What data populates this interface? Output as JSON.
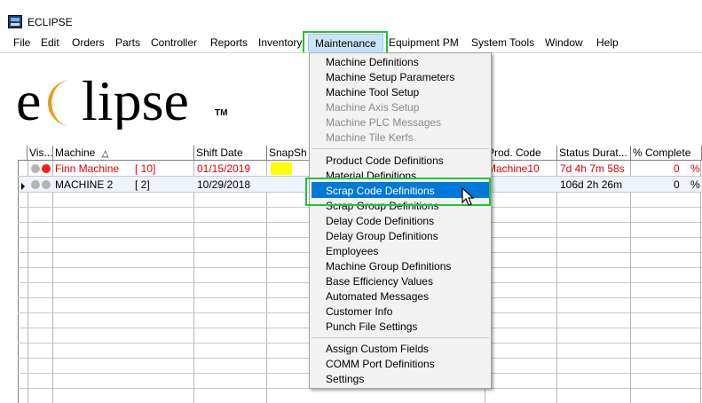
{
  "window": {
    "title": "ECLIPSE"
  },
  "menubar": {
    "items": [
      "File",
      "Edit",
      "Orders",
      "Parts",
      "Controller",
      "Reports",
      "Inventory",
      "Maintenance",
      "Equipment PM",
      "System Tools",
      "Window",
      "Help"
    ],
    "active": "Maintenance"
  },
  "logo": {
    "text": "eclipse",
    "trademark": "TM"
  },
  "grid": {
    "columns": [
      "Vis...",
      "Machine",
      "Shift Date",
      "SnapSh",
      "Prod. Code",
      "Status Durat...",
      "% Complete"
    ],
    "rows": [
      {
        "machine": "Finn Machine",
        "machine_id": "[ 10]",
        "shift_date": "01/15/2019",
        "prod_code": "Machine10",
        "status_duration": "7d 4h 7m 58s",
        "complete": "0",
        "pct": "%",
        "color": "#e00000"
      },
      {
        "machine": "MACHINE 2",
        "machine_id": "[ 2]",
        "shift_date": "10/29/2018",
        "prod_code": "",
        "status_duration": "106d 2h 26m",
        "complete": "0",
        "pct": "%",
        "color": "#000000"
      }
    ]
  },
  "maintenance_menu": {
    "group1": [
      {
        "label": "Machine Definitions",
        "enabled": true
      },
      {
        "label": "Machine Setup Parameters",
        "enabled": true
      },
      {
        "label": "Machine Tool Setup",
        "enabled": true
      },
      {
        "label": "Machine Axis Setup",
        "enabled": false
      },
      {
        "label": "Machine PLC Messages",
        "enabled": false
      },
      {
        "label": "Machine Tile Kerfs",
        "enabled": false
      }
    ],
    "group2": [
      {
        "label": "Product Code Definitions",
        "enabled": true
      },
      {
        "label": "Material Definitions",
        "enabled": true
      },
      {
        "label": "Scrap Code Definitions",
        "enabled": true,
        "highlighted": true
      },
      {
        "label": "Scrap Group Definitions",
        "enabled": true
      },
      {
        "label": "Delay Code Definitions",
        "enabled": true
      },
      {
        "label": "Delay Group Definitions",
        "enabled": true
      },
      {
        "label": "Employees",
        "enabled": true
      },
      {
        "label": "Machine Group Definitions",
        "enabled": true
      },
      {
        "label": "Base Efficiency Values",
        "enabled": true
      },
      {
        "label": "Automated Messages",
        "enabled": true
      },
      {
        "label": "Customer Info",
        "enabled": true
      },
      {
        "label": "Punch File Settings",
        "enabled": true
      }
    ],
    "group3": [
      {
        "label": "Assign Custom Fields",
        "enabled": true
      },
      {
        "label": "COMM Port Definitions",
        "enabled": true
      },
      {
        "label": "Settings",
        "enabled": true
      }
    ]
  },
  "colors": {
    "highlight_green": "#22c43a",
    "menu_selection": "#0078d7",
    "menu_active_bg": "#cce4f7",
    "alarm_red": "#e00000"
  }
}
